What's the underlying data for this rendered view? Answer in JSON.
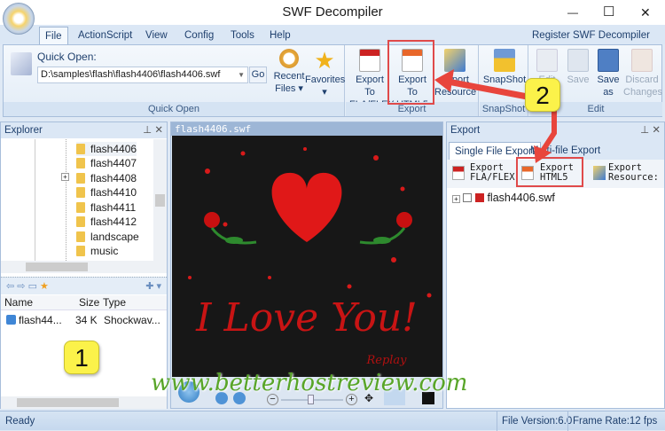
{
  "window": {
    "title": "SWF Decompiler",
    "minimize": "—",
    "maximize": "☐",
    "close": "✕"
  },
  "menu": {
    "tabs": [
      "File",
      "ActionScript",
      "View",
      "Config",
      "Tools",
      "Help"
    ],
    "register": "Register SWF Decompiler Now!"
  },
  "ribbon": {
    "quick_open_label": "Quick Open:",
    "path": "D:\\samples\\flash\\flash4406\\flash4406.swf",
    "go": "Go",
    "recent": "Recent",
    "recent2": "Files ▾",
    "favorites": "Favorites",
    "favorites2": "▾",
    "group_quick_open": "Quick Open",
    "export_fla": "Export To",
    "export_fla2": "FLA/FLEX",
    "export_html5": "Export To",
    "export_html52": "HTML5",
    "export_res": "Export",
    "export_res2": "Resource",
    "group_export": "Export",
    "snapshot": "SnapShot",
    "snapshot2": "▾",
    "group_snapshot": "SnapShot",
    "edit": "Edit",
    "save": "Save",
    "save_as": "Save",
    "save_as2": "as",
    "discard": "Discard",
    "discard2": "Changes",
    "group_edit": "Edit"
  },
  "explorer": {
    "title": "Explorer",
    "folders": [
      "flash4406",
      "flash4407",
      "flash4408",
      "flash4410",
      "flash4411",
      "flash4412",
      "landscape",
      "music"
    ],
    "columns": [
      "Name",
      "Size",
      "Type"
    ],
    "files": [
      {
        "name": "flash44...",
        "size": "34 K",
        "type": "Shockwav..."
      }
    ]
  },
  "preview": {
    "title": "flash4406.swf",
    "love_text": "I Love You!",
    "replay": "Replay"
  },
  "export_panel": {
    "title": "Export",
    "tabs": [
      "Single File Export",
      "Multi-file Export"
    ],
    "buttons": [
      {
        "l1": "Export",
        "l2": "FLA/FLEX"
      },
      {
        "l1": "Export",
        "l2": "HTML5"
      },
      {
        "l1": "Export",
        "l2": "Resource:"
      }
    ],
    "file": "flash4406.swf"
  },
  "status": {
    "left": "Ready",
    "file_version": "File Version:6.0",
    "frame_rate": "Frame Rate:12 fps"
  },
  "annotations": {
    "callout1": "1",
    "callout2": "2",
    "watermark": "www.betterhostreview.com"
  },
  "colors": {
    "accent": "#1e3f6d",
    "highlight": "#e04a4a",
    "callout": "#fbf24a"
  }
}
